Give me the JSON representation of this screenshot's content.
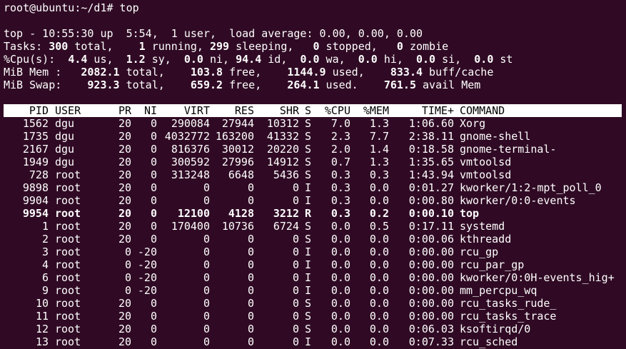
{
  "prompt": "root@ubuntu:~/d1# top",
  "summary": {
    "top_line": "top - 10:55:30 up  5:54,  1 user,  load average: 0.00, 0.00, 0.00",
    "tasks": {
      "label": "Tasks: ",
      "total": "300",
      "total_t": " total,    ",
      "running": "1",
      "running_t": " running, ",
      "sleeping": "299",
      "sleeping_t": " sleeping,   ",
      "stopped": "0",
      "stopped_t": " stopped,   ",
      "zombie": "0",
      "zombie_t": " zombie"
    },
    "cpu": {
      "label": "%Cpu(s):  ",
      "us": "4.4",
      "us_t": " us,  ",
      "sy": "1.2",
      "sy_t": " sy,  ",
      "ni": "0.0",
      "ni_t": " ni, ",
      "id": "94.4",
      "id_t": " id,  ",
      "wa": "0.0",
      "wa_t": " wa,  ",
      "hi": "0.0",
      "hi_t": " hi,  ",
      "si": "0.0",
      "si_t": " si,  ",
      "st": "0.0",
      "st_t": " st"
    },
    "mem": {
      "label": "MiB Mem :   ",
      "total": "2082.1",
      "total_t": " total,    ",
      "free": "103.8",
      "free_t": " free,    ",
      "used": "1144.9",
      "used_t": " used,    ",
      "cache": "833.4",
      "cache_t": " buff/cache"
    },
    "swap": {
      "label": "MiB Swap:    ",
      "total": "923.3",
      "total_t": " total,    ",
      "free": "659.2",
      "free_t": " free,    ",
      "used": "264.1",
      "used_t": " used.    ",
      "avail": "761.5",
      "avail_t": " avail Mem"
    }
  },
  "columns": {
    "pid": "PID",
    "user": "USER",
    "pr": "PR",
    "ni": "NI",
    "virt": "VIRT",
    "res": "RES",
    "shr": "SHR",
    "s": "S",
    "cpu": "%CPU",
    "mem": "%MEM",
    "time": "TIME+",
    "command": "COMMAND"
  },
  "processes": [
    {
      "pid": "1562",
      "user": "dgu",
      "pr": "20",
      "ni": "0",
      "virt": "290084",
      "res": "27944",
      "shr": "10312",
      "s": "S",
      "cpu": "7.0",
      "mem": "1.3",
      "time": "1:06.60",
      "command": "Xorg"
    },
    {
      "pid": "1735",
      "user": "dgu",
      "pr": "20",
      "ni": "0",
      "virt": "4032772",
      "res": "163200",
      "shr": "41332",
      "s": "S",
      "cpu": "2.3",
      "mem": "7.7",
      "time": "2:38.11",
      "command": "gnome-shell"
    },
    {
      "pid": "2167",
      "user": "dgu",
      "pr": "20",
      "ni": "0",
      "virt": "816376",
      "res": "30012",
      "shr": "20220",
      "s": "S",
      "cpu": "2.0",
      "mem": "1.4",
      "time": "0:18.58",
      "command": "gnome-terminal-"
    },
    {
      "pid": "1949",
      "user": "dgu",
      "pr": "20",
      "ni": "0",
      "virt": "300592",
      "res": "27996",
      "shr": "14912",
      "s": "S",
      "cpu": "0.7",
      "mem": "1.3",
      "time": "1:35.65",
      "command": "vmtoolsd"
    },
    {
      "pid": "728",
      "user": "root",
      "pr": "20",
      "ni": "0",
      "virt": "313248",
      "res": "6648",
      "shr": "5436",
      "s": "S",
      "cpu": "0.3",
      "mem": "0.3",
      "time": "1:43.94",
      "command": "vmtoolsd"
    },
    {
      "pid": "9898",
      "user": "root",
      "pr": "20",
      "ni": "0",
      "virt": "0",
      "res": "0",
      "shr": "0",
      "s": "I",
      "cpu": "0.3",
      "mem": "0.0",
      "time": "0:01.27",
      "command": "kworker/1:2-mpt_poll_0"
    },
    {
      "pid": "9904",
      "user": "root",
      "pr": "20",
      "ni": "0",
      "virt": "0",
      "res": "0",
      "shr": "0",
      "s": "I",
      "cpu": "0.3",
      "mem": "0.0",
      "time": "0:00.80",
      "command": "kworker/0:0-events"
    },
    {
      "pid": "9954",
      "user": "root",
      "pr": "20",
      "ni": "0",
      "virt": "12100",
      "res": "4128",
      "shr": "3212",
      "s": "R",
      "cpu": "0.3",
      "mem": "0.2",
      "time": "0:00.10",
      "command": "top",
      "bold": true
    },
    {
      "pid": "1",
      "user": "root",
      "pr": "20",
      "ni": "0",
      "virt": "170400",
      "res": "10736",
      "shr": "6724",
      "s": "S",
      "cpu": "0.0",
      "mem": "0.5",
      "time": "0:17.11",
      "command": "systemd"
    },
    {
      "pid": "2",
      "user": "root",
      "pr": "20",
      "ni": "0",
      "virt": "0",
      "res": "0",
      "shr": "0",
      "s": "S",
      "cpu": "0.0",
      "mem": "0.0",
      "time": "0:00.06",
      "command": "kthreadd"
    },
    {
      "pid": "3",
      "user": "root",
      "pr": "0",
      "ni": "-20",
      "virt": "0",
      "res": "0",
      "shr": "0",
      "s": "I",
      "cpu": "0.0",
      "mem": "0.0",
      "time": "0:00.00",
      "command": "rcu_gp"
    },
    {
      "pid": "4",
      "user": "root",
      "pr": "0",
      "ni": "-20",
      "virt": "0",
      "res": "0",
      "shr": "0",
      "s": "I",
      "cpu": "0.0",
      "mem": "0.0",
      "time": "0:00.00",
      "command": "rcu_par_gp"
    },
    {
      "pid": "6",
      "user": "root",
      "pr": "0",
      "ni": "-20",
      "virt": "0",
      "res": "0",
      "shr": "0",
      "s": "I",
      "cpu": "0.0",
      "mem": "0.0",
      "time": "0:00.00",
      "command": "kworker/0:0H-events_hig+"
    },
    {
      "pid": "9",
      "user": "root",
      "pr": "0",
      "ni": "-20",
      "virt": "0",
      "res": "0",
      "shr": "0",
      "s": "I",
      "cpu": "0.0",
      "mem": "0.0",
      "time": "0:00.00",
      "command": "mm_percpu_wq"
    },
    {
      "pid": "10",
      "user": "root",
      "pr": "20",
      "ni": "0",
      "virt": "0",
      "res": "0",
      "shr": "0",
      "s": "S",
      "cpu": "0.0",
      "mem": "0.0",
      "time": "0:00.00",
      "command": "rcu_tasks_rude_"
    },
    {
      "pid": "11",
      "user": "root",
      "pr": "20",
      "ni": "0",
      "virt": "0",
      "res": "0",
      "shr": "0",
      "s": "S",
      "cpu": "0.0",
      "mem": "0.0",
      "time": "0:00.00",
      "command": "rcu_tasks_trace"
    },
    {
      "pid": "12",
      "user": "root",
      "pr": "20",
      "ni": "0",
      "virt": "0",
      "res": "0",
      "shr": "0",
      "s": "S",
      "cpu": "0.0",
      "mem": "0.0",
      "time": "0:06.03",
      "command": "ksoftirqd/0"
    },
    {
      "pid": "13",
      "user": "root",
      "pr": "20",
      "ni": "0",
      "virt": "0",
      "res": "0",
      "shr": "0",
      "s": "I",
      "cpu": "0.0",
      "mem": "0.0",
      "time": "0:07.33",
      "command": "rcu_sched"
    }
  ]
}
